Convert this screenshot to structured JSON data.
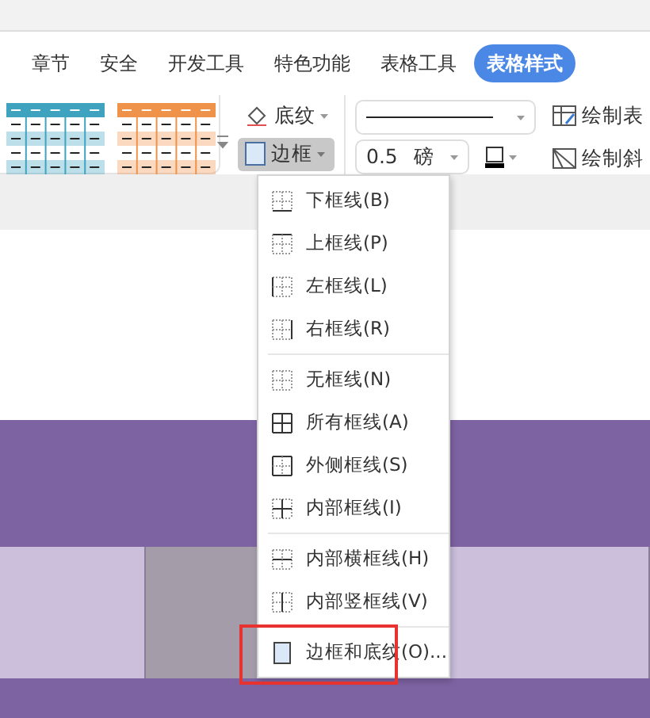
{
  "tabs": [
    {
      "label": "章节",
      "selected": false
    },
    {
      "label": "安全",
      "selected": false
    },
    {
      "label": "开发工具",
      "selected": false
    },
    {
      "label": "特色功能",
      "selected": false
    },
    {
      "label": "表格工具",
      "selected": false
    },
    {
      "label": "表格样式",
      "selected": true
    }
  ],
  "ribbon": {
    "table_styles": [
      {
        "color": "#3fa3c0"
      },
      {
        "color": "#f0934a"
      }
    ],
    "shading_button": {
      "label": "底纹"
    },
    "border_button": {
      "label": "边框",
      "pressed": true
    },
    "line_width": {
      "value": "0.5",
      "unit": "磅"
    },
    "draw_table": {
      "label": "绘制表"
    },
    "draw_diagonal": {
      "label": "绘制斜"
    }
  },
  "document": {
    "table_cells": [
      {
        "selected": false
      },
      {
        "selected": true
      },
      {
        "selected": false
      }
    ]
  },
  "menu": {
    "groups": [
      {
        "items": [
          {
            "kind": "bottom",
            "label": "下框线(B)",
            "highlighted": false
          },
          {
            "kind": "top",
            "label": "上框线(P)",
            "highlighted": false
          },
          {
            "kind": "left",
            "label": "左框线(L)",
            "highlighted": false
          },
          {
            "kind": "right",
            "label": "右框线(R)",
            "highlighted": false
          }
        ]
      },
      {
        "items": [
          {
            "kind": "none",
            "label": "无框线(N)",
            "highlighted": false
          },
          {
            "kind": "all",
            "label": "所有框线(A)",
            "highlighted": false
          },
          {
            "kind": "outside",
            "label": "外侧框线(S)",
            "highlighted": false
          },
          {
            "kind": "inside",
            "label": "内部框线(I)",
            "highlighted": false
          }
        ]
      },
      {
        "items": [
          {
            "kind": "inside-h",
            "label": "内部横框线(H)",
            "highlighted": false
          },
          {
            "kind": "inside-v",
            "label": "内部竖框线(V)",
            "highlighted": false
          }
        ]
      },
      {
        "items": [
          {
            "kind": "dialog",
            "label": "边框和底纹(O)...",
            "highlighted": true
          }
        ]
      }
    ]
  }
}
